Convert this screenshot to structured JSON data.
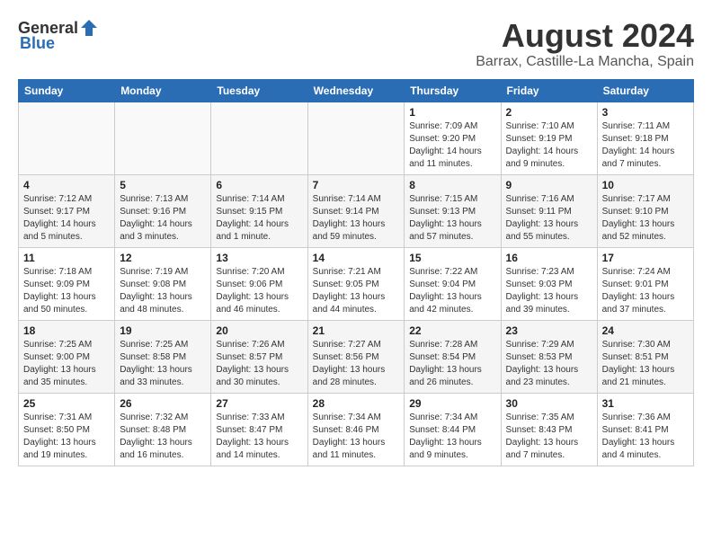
{
  "logo": {
    "general": "General",
    "blue": "Blue"
  },
  "title": "August 2024",
  "subtitle": "Barrax, Castille-La Mancha, Spain",
  "days_of_week": [
    "Sunday",
    "Monday",
    "Tuesday",
    "Wednesday",
    "Thursday",
    "Friday",
    "Saturday"
  ],
  "weeks": [
    [
      {
        "day": "",
        "content": ""
      },
      {
        "day": "",
        "content": ""
      },
      {
        "day": "",
        "content": ""
      },
      {
        "day": "",
        "content": ""
      },
      {
        "day": "1",
        "content": "Sunrise: 7:09 AM\nSunset: 9:20 PM\nDaylight: 14 hours\nand 11 minutes."
      },
      {
        "day": "2",
        "content": "Sunrise: 7:10 AM\nSunset: 9:19 PM\nDaylight: 14 hours\nand 9 minutes."
      },
      {
        "day": "3",
        "content": "Sunrise: 7:11 AM\nSunset: 9:18 PM\nDaylight: 14 hours\nand 7 minutes."
      }
    ],
    [
      {
        "day": "4",
        "content": "Sunrise: 7:12 AM\nSunset: 9:17 PM\nDaylight: 14 hours\nand 5 minutes."
      },
      {
        "day": "5",
        "content": "Sunrise: 7:13 AM\nSunset: 9:16 PM\nDaylight: 14 hours\nand 3 minutes."
      },
      {
        "day": "6",
        "content": "Sunrise: 7:14 AM\nSunset: 9:15 PM\nDaylight: 14 hours\nand 1 minute."
      },
      {
        "day": "7",
        "content": "Sunrise: 7:14 AM\nSunset: 9:14 PM\nDaylight: 13 hours\nand 59 minutes."
      },
      {
        "day": "8",
        "content": "Sunrise: 7:15 AM\nSunset: 9:13 PM\nDaylight: 13 hours\nand 57 minutes."
      },
      {
        "day": "9",
        "content": "Sunrise: 7:16 AM\nSunset: 9:11 PM\nDaylight: 13 hours\nand 55 minutes."
      },
      {
        "day": "10",
        "content": "Sunrise: 7:17 AM\nSunset: 9:10 PM\nDaylight: 13 hours\nand 52 minutes."
      }
    ],
    [
      {
        "day": "11",
        "content": "Sunrise: 7:18 AM\nSunset: 9:09 PM\nDaylight: 13 hours\nand 50 minutes."
      },
      {
        "day": "12",
        "content": "Sunrise: 7:19 AM\nSunset: 9:08 PM\nDaylight: 13 hours\nand 48 minutes."
      },
      {
        "day": "13",
        "content": "Sunrise: 7:20 AM\nSunset: 9:06 PM\nDaylight: 13 hours\nand 46 minutes."
      },
      {
        "day": "14",
        "content": "Sunrise: 7:21 AM\nSunset: 9:05 PM\nDaylight: 13 hours\nand 44 minutes."
      },
      {
        "day": "15",
        "content": "Sunrise: 7:22 AM\nSunset: 9:04 PM\nDaylight: 13 hours\nand 42 minutes."
      },
      {
        "day": "16",
        "content": "Sunrise: 7:23 AM\nSunset: 9:03 PM\nDaylight: 13 hours\nand 39 minutes."
      },
      {
        "day": "17",
        "content": "Sunrise: 7:24 AM\nSunset: 9:01 PM\nDaylight: 13 hours\nand 37 minutes."
      }
    ],
    [
      {
        "day": "18",
        "content": "Sunrise: 7:25 AM\nSunset: 9:00 PM\nDaylight: 13 hours\nand 35 minutes."
      },
      {
        "day": "19",
        "content": "Sunrise: 7:25 AM\nSunset: 8:58 PM\nDaylight: 13 hours\nand 33 minutes."
      },
      {
        "day": "20",
        "content": "Sunrise: 7:26 AM\nSunset: 8:57 PM\nDaylight: 13 hours\nand 30 minutes."
      },
      {
        "day": "21",
        "content": "Sunrise: 7:27 AM\nSunset: 8:56 PM\nDaylight: 13 hours\nand 28 minutes."
      },
      {
        "day": "22",
        "content": "Sunrise: 7:28 AM\nSunset: 8:54 PM\nDaylight: 13 hours\nand 26 minutes."
      },
      {
        "day": "23",
        "content": "Sunrise: 7:29 AM\nSunset: 8:53 PM\nDaylight: 13 hours\nand 23 minutes."
      },
      {
        "day": "24",
        "content": "Sunrise: 7:30 AM\nSunset: 8:51 PM\nDaylight: 13 hours\nand 21 minutes."
      }
    ],
    [
      {
        "day": "25",
        "content": "Sunrise: 7:31 AM\nSunset: 8:50 PM\nDaylight: 13 hours\nand 19 minutes."
      },
      {
        "day": "26",
        "content": "Sunrise: 7:32 AM\nSunset: 8:48 PM\nDaylight: 13 hours\nand 16 minutes."
      },
      {
        "day": "27",
        "content": "Sunrise: 7:33 AM\nSunset: 8:47 PM\nDaylight: 13 hours\nand 14 minutes."
      },
      {
        "day": "28",
        "content": "Sunrise: 7:34 AM\nSunset: 8:46 PM\nDaylight: 13 hours\nand 11 minutes."
      },
      {
        "day": "29",
        "content": "Sunrise: 7:34 AM\nSunset: 8:44 PM\nDaylight: 13 hours\nand 9 minutes."
      },
      {
        "day": "30",
        "content": "Sunrise: 7:35 AM\nSunset: 8:43 PM\nDaylight: 13 hours\nand 7 minutes."
      },
      {
        "day": "31",
        "content": "Sunrise: 7:36 AM\nSunset: 8:41 PM\nDaylight: 13 hours\nand 4 minutes."
      }
    ]
  ],
  "colors": {
    "header_bg": "#2a6db5",
    "header_text": "#ffffff",
    "title_color": "#333333"
  }
}
